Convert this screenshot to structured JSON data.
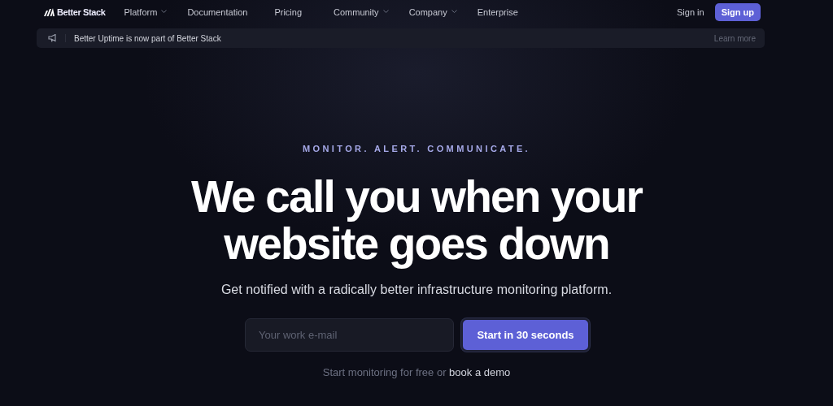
{
  "nav": {
    "logo": "Better Stack",
    "items": [
      {
        "label": "Platform",
        "has_menu": true
      },
      {
        "label": "Documentation",
        "has_menu": false
      },
      {
        "label": "Pricing",
        "has_menu": false
      },
      {
        "label": "Community",
        "has_menu": true
      },
      {
        "label": "Company",
        "has_menu": true
      },
      {
        "label": "Enterprise",
        "has_menu": false
      }
    ],
    "sign_in": "Sign in",
    "sign_up": "Sign up"
  },
  "banner": {
    "text": "Better Uptime is now part of Better Stack",
    "link": "Learn more"
  },
  "hero": {
    "tagline": "MONITOR. ALERT. COMMUNICATE.",
    "heading": [
      "We call you when your",
      "website goes down"
    ],
    "subtitle": "Get notified with a radically better infrastructure monitoring platform.",
    "email": {
      "placeholder": "Your work e-mail"
    },
    "cta": "Start in 30 seconds",
    "footnote": {
      "text": "Start monitoring for free or ",
      "link": "book a demo"
    }
  }
}
